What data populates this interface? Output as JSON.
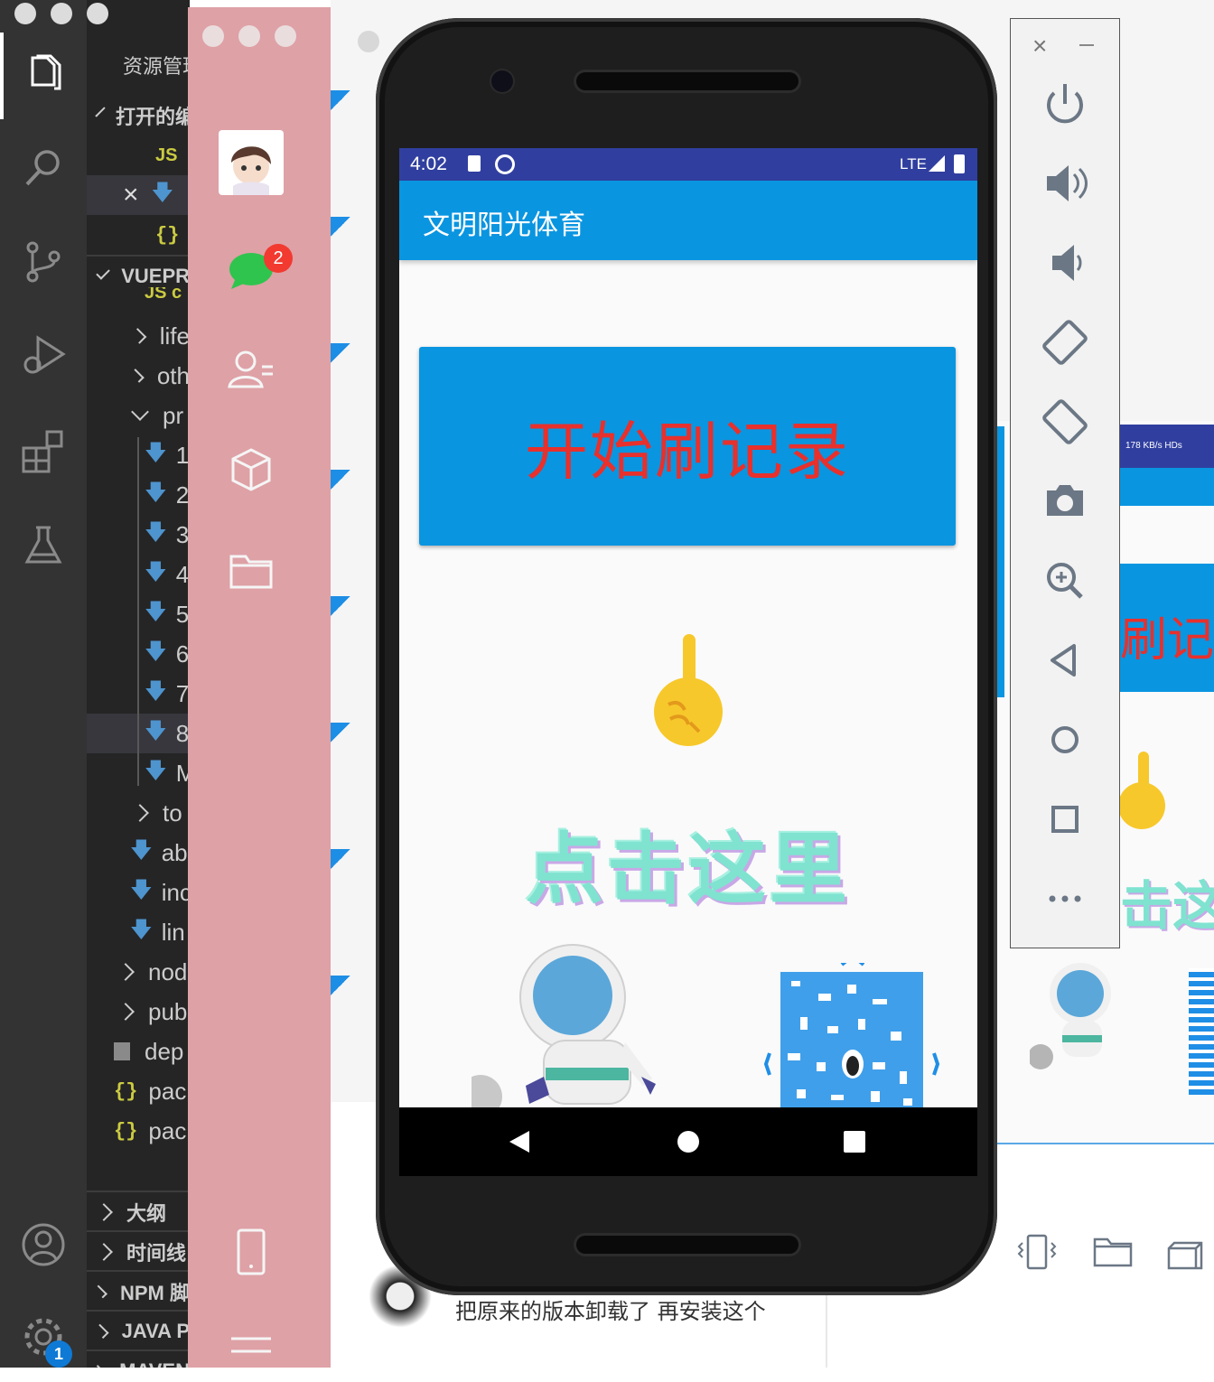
{
  "vscode": {
    "explorer_title": "资源管理",
    "open_editors_label": "打开的编",
    "project_label": "VUEPR",
    "open_editor_items": [
      {
        "icon": "js-icon",
        "label": "JS"
      },
      {
        "icon": "download-icon",
        "label": ""
      },
      {
        "icon": "json-icon",
        "label": "{}"
      }
    ],
    "tree_items": [
      {
        "label": "JS c",
        "kind": "js"
      },
      {
        "label": "life",
        "kind": "folder-collapsed"
      },
      {
        "label": "oth",
        "kind": "folder-collapsed"
      },
      {
        "label": "pr",
        "kind": "folder-expanded"
      },
      {
        "label": "1",
        "kind": "download"
      },
      {
        "label": "2",
        "kind": "download"
      },
      {
        "label": "3",
        "kind": "download"
      },
      {
        "label": "4",
        "kind": "download"
      },
      {
        "label": "5",
        "kind": "download"
      },
      {
        "label": "6",
        "kind": "download"
      },
      {
        "label": "7",
        "kind": "download"
      },
      {
        "label": "8",
        "kind": "download"
      },
      {
        "label": "M",
        "kind": "download"
      },
      {
        "label": "to",
        "kind": "folder-collapsed"
      },
      {
        "label": "ab",
        "kind": "download"
      },
      {
        "label": "inc",
        "kind": "download"
      },
      {
        "label": "lin",
        "kind": "download"
      },
      {
        "label": "nod",
        "kind": "folder-collapsed"
      },
      {
        "label": "pub",
        "kind": "folder-collapsed"
      },
      {
        "label": "dep",
        "kind": "file"
      },
      {
        "label": "pac",
        "kind": "json"
      },
      {
        "label": "pac",
        "kind": "json"
      }
    ],
    "bottom_sections": [
      "大纲",
      "时间线",
      "NPM 脚",
      "JAVA P",
      "MAVEN"
    ],
    "settings_badge": "1"
  },
  "chat_sidebar": {
    "unread_badge": "2"
  },
  "chat": {
    "last_message": "把原来的版本卸载了 再安装这个"
  },
  "phone": {
    "status_time": "4:02",
    "status_network": "LTE",
    "app_title": "文明阳光体育",
    "start_button_label": "开始刷记录",
    "click_hint": "点击这里"
  },
  "preview": {
    "status_text": "178 KB/s HDs",
    "button_text": "刷记",
    "click_text": "击这里"
  },
  "colors": {
    "status_bar": "#303f9f",
    "app_bar": "#0a95e0",
    "button_text": "#e8302c",
    "pink_sidebar": "#dea1a6",
    "vscode_bg": "#252526"
  }
}
